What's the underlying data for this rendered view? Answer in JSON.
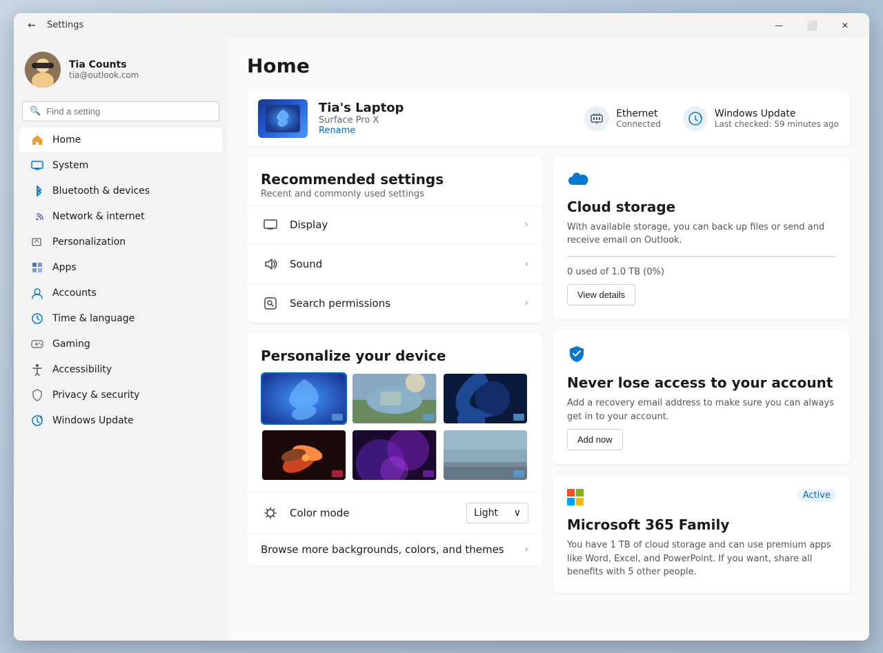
{
  "window": {
    "title": "Settings",
    "back_title": "Settings"
  },
  "titlebar": {
    "minimize": "—",
    "maximize": "⬜",
    "close": "✕"
  },
  "user": {
    "name": "Tia Counts",
    "email": "tia@outlook.com",
    "avatar_emoji": "👩"
  },
  "search": {
    "placeholder": "Find a setting"
  },
  "nav": {
    "items": [
      {
        "id": "home",
        "label": "Home",
        "active": true
      },
      {
        "id": "system",
        "label": "System",
        "active": false
      },
      {
        "id": "bluetooth",
        "label": "Bluetooth & devices",
        "active": false
      },
      {
        "id": "network",
        "label": "Network & internet",
        "active": false
      },
      {
        "id": "personalization",
        "label": "Personalization",
        "active": false
      },
      {
        "id": "apps",
        "label": "Apps",
        "active": false
      },
      {
        "id": "accounts",
        "label": "Accounts",
        "active": false
      },
      {
        "id": "time",
        "label": "Time & language",
        "active": false
      },
      {
        "id": "gaming",
        "label": "Gaming",
        "active": false
      },
      {
        "id": "accessibility",
        "label": "Accessibility",
        "active": false
      },
      {
        "id": "privacy",
        "label": "Privacy & security",
        "active": false
      },
      {
        "id": "winupdate",
        "label": "Windows Update",
        "active": false
      }
    ]
  },
  "page": {
    "title": "Home"
  },
  "device": {
    "name": "Tia's Laptop",
    "model": "Surface Pro X",
    "rename": "Rename"
  },
  "status_items": [
    {
      "id": "ethernet",
      "label": "Ethernet",
      "sub": "Connected"
    },
    {
      "id": "windows_update",
      "label": "Windows Update",
      "sub": "Last checked: 59 minutes ago"
    }
  ],
  "recommended": {
    "title": "Recommended settings",
    "subtitle": "Recent and commonly used settings",
    "rows": [
      {
        "id": "display",
        "label": "Display"
      },
      {
        "id": "sound",
        "label": "Sound"
      },
      {
        "id": "search_permissions",
        "label": "Search permissions"
      }
    ]
  },
  "personalize": {
    "title": "Personalize your device",
    "color_mode_label": "Color mode",
    "color_mode_value": "Light",
    "browse_label": "Browse more backgrounds, colors, and themes"
  },
  "cloud_storage": {
    "title": "Cloud storage",
    "text": "With available storage, you can back up files or send and receive email on Outlook.",
    "usage": "0 used of 1.0 TB (0%)",
    "btn": "View details"
  },
  "account_security": {
    "title": "Never lose access to your account",
    "text": "Add a recovery email address to make sure you can always get in to your account.",
    "btn": "Add now"
  },
  "microsoft365": {
    "title": "Microsoft 365 Family",
    "text": "You have 1 TB of cloud storage and can use premium apps like Word, Excel, and PowerPoint. If you want, share all benefits with 5 other people.",
    "badge": "Active"
  }
}
